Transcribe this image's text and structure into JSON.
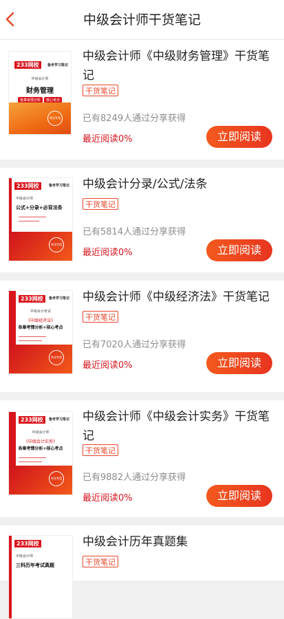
{
  "header": {
    "title": "中级会计师干货笔记"
  },
  "colors": {
    "accent": "#e8452a",
    "button": "#ef4a1f",
    "progress_text": "#d4141c"
  },
  "icons": {
    "back": "chevron-left-icon"
  },
  "books": [
    {
      "title": "中级会计师《中级财务管理》干货笔记",
      "badge": "干货笔记",
      "shares": "已有8249人通过分享获得",
      "progress": "最近阅读0%",
      "button": "立即阅读",
      "cover": {
        "logo": "233网校",
        "tag": "备考学习笔记",
        "line1": "中级会计师",
        "line2": "财务管理",
        "pill1": "各章考情分析",
        "pill2": "核心考点",
        "stamp": "考试专用"
      }
    },
    {
      "title": "中级会计分录/公式/法条",
      "badge": "干货笔记",
      "shares": "已有5814人通过分享获得",
      "progress": "最近阅读0%",
      "button": "立即阅读",
      "cover": {
        "logo": "233网校",
        "tag": "备考学习笔记",
        "line1": "中级会计师",
        "line2": "公式+分录+必背法条",
        "stamp": "考试专用"
      }
    },
    {
      "title": "中级会计师《中级经济法》干货笔记",
      "badge": "干货笔记",
      "shares": "已有7020人通过分享获得",
      "progress": "最近阅读0%",
      "button": "立即阅读",
      "cover": {
        "logo": "233网校",
        "tag": "备考学习笔记",
        "line1": "中级会计考试",
        "line1b": "《中级经济法》",
        "line2": "各章考情分析+核心考点",
        "stamp": "考试专用"
      }
    },
    {
      "title": "中级会计师《中级会计实务》干货笔记",
      "badge": "干货笔记",
      "shares": "已有9882人通过分享获得",
      "progress": "最近阅读0%",
      "button": "立即阅读",
      "cover": {
        "logo": "233网校",
        "tag": "备考学习笔记",
        "line1": "中级会计师",
        "line1b": "《中级会计实务》",
        "line2": "各章考情分析+核心考点",
        "stamp": "考试专用"
      }
    },
    {
      "title": "中级会计历年真题集",
      "badge": "干货笔记",
      "cover": {
        "logo": "233网校",
        "line1": "中级会计师",
        "line2": "三科历年考试真题"
      }
    }
  ]
}
